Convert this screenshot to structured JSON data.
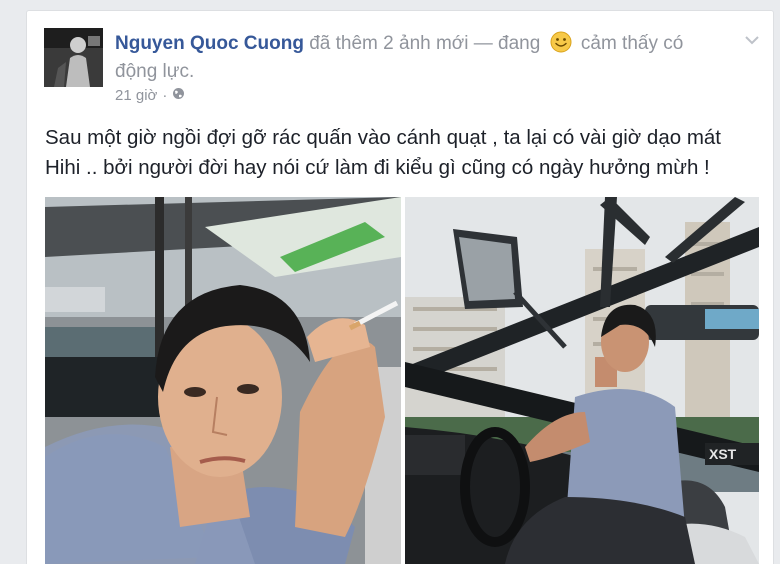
{
  "post": {
    "author": "Nguyen Quoc Cuong",
    "action_text": "đã thêm 2 ảnh mới — đang",
    "feeling_text": "cảm thấy có động lực.",
    "timestamp": "21 giờ",
    "separator": "·",
    "privacy_icon": "globe-icon",
    "options_icon": "chevron-down-icon",
    "feeling_icon": "smiley-icon",
    "text_line_1": "Sau một giờ ngồi đợi gỡ rác quấn vào cánh quạt , ta lại có vài giờ dạo mát",
    "text_line_2": "Hihi .. bởi người đời hay nói cứ làm đi kiểu gì cũng có ngày hưởng mừh !"
  },
  "photos": [
    {
      "name": "selfie-on-boat-photo"
    },
    {
      "name": "driving-boat-photo"
    }
  ],
  "colors": {
    "author": "#365899",
    "meta": "#90949c",
    "text": "#1d2129",
    "background": "#e9ebee"
  }
}
